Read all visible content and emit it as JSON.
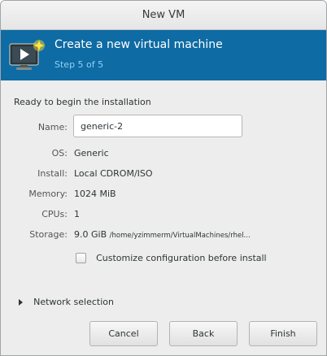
{
  "window": {
    "title": "New VM"
  },
  "header": {
    "icon": "new-vm-monitor-icon",
    "title": "Create a new virtual machine",
    "step": "Step 5 of 5"
  },
  "summary": {
    "ready_text": "Ready to begin the installation",
    "name_label": "Name:",
    "name_value": "generic-2",
    "os_label": "OS:",
    "os_value": "Generic",
    "install_label": "Install:",
    "install_value": "Local CDROM/ISO",
    "memory_label": "Memory:",
    "memory_value": "1024 MiB",
    "cpus_label": "CPUs:",
    "cpus_value": "1",
    "storage_label": "Storage:",
    "storage_size": "9.0 GiB",
    "storage_path": "/home/yzimmerm/VirtualMachines/rhel..."
  },
  "options": {
    "customize_label": "Customize configuration before install",
    "customize_checked": false,
    "network_expander_label": "Network selection"
  },
  "buttons": {
    "cancel": "Cancel",
    "back": "Back",
    "finish": "Finish"
  },
  "colors": {
    "header_bg": "#0e6ba4",
    "step_text": "#8fd0f5"
  }
}
